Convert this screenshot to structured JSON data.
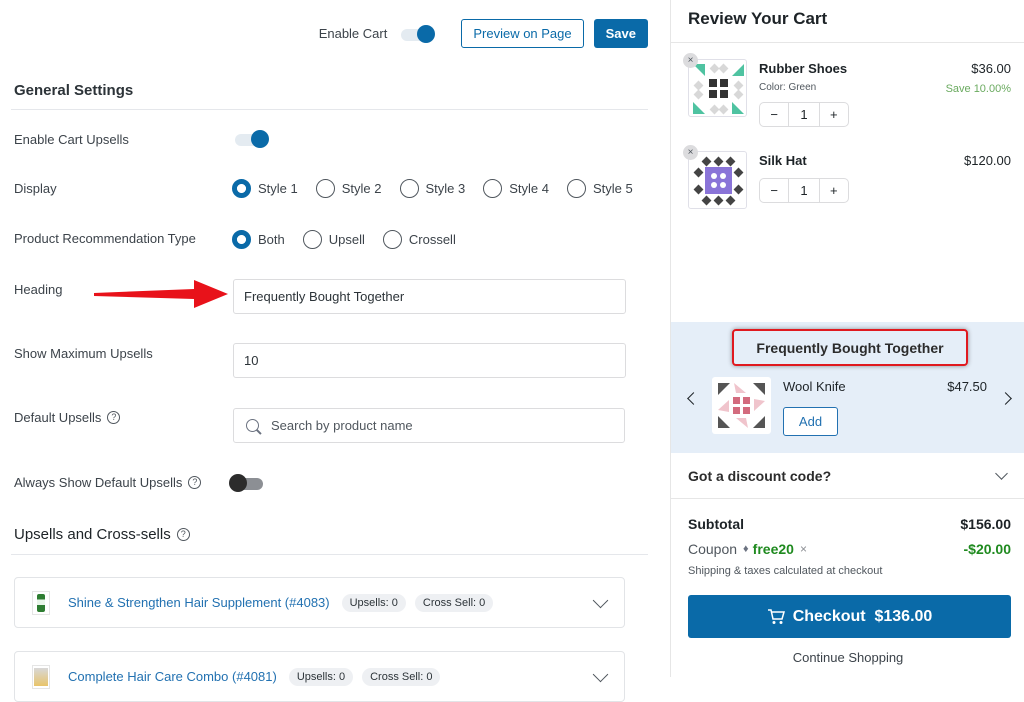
{
  "topbar": {
    "enable_cart_label": "Enable Cart",
    "enable_cart_on": true,
    "preview_label": "Preview on Page",
    "save_label": "Save"
  },
  "general": {
    "title": "General Settings",
    "enable_upsells_label": "Enable Cart Upsells",
    "enable_upsells_on": true,
    "display_label": "Display",
    "display_options": [
      "Style 1",
      "Style 2",
      "Style 3",
      "Style 4",
      "Style 5"
    ],
    "display_selected": "Style 1",
    "rec_type_label": "Product Recommendation Type",
    "rec_type_options": [
      "Both",
      "Upsell",
      "Crossell"
    ],
    "rec_type_selected": "Both",
    "heading_label": "Heading",
    "heading_value": "Frequently Bought Together",
    "max_upsells_label": "Show Maximum Upsells",
    "max_upsells_value": "10",
    "default_upsells_label": "Default Upsells",
    "default_upsells_placeholder": "Search by product name",
    "always_show_label": "Always Show Default Upsells",
    "always_show_on": false,
    "help_glyph": "?"
  },
  "upsells_section": {
    "title": "Upsells and Cross-sells",
    "products": [
      {
        "name": "Shine & Strengthen Hair Supplement (#4083)",
        "upsells": "Upsells: 0",
        "cross_sell": "Cross Sell: 0"
      },
      {
        "name": "Complete Hair Care Combo (#4081)",
        "upsells": "Upsells: 0",
        "cross_sell": "Cross Sell: 0"
      }
    ]
  },
  "cart": {
    "title": "Review Your Cart",
    "remove_glyph": "×",
    "items": [
      {
        "name": "Rubber Shoes",
        "variant": "Color: Green",
        "price": "$36.00",
        "save": "Save 10.00%",
        "qty": "1"
      },
      {
        "name": "Silk Hat",
        "price": "$120.00",
        "qty": "1"
      }
    ],
    "qty_minus": "−",
    "qty_plus": "+",
    "fbt": {
      "title": "Frequently Bought Together",
      "product_name": "Wool Knife",
      "product_price": "$47.50",
      "add_label": "Add"
    },
    "discount_label": "Got a discount code?",
    "subtotal_label": "Subtotal",
    "subtotal_value": "$156.00",
    "coupon_label": "Coupon",
    "coupon_code": "free20",
    "coupon_remove": "×",
    "coupon_value": "-$20.00",
    "shipping_note": "Shipping & taxes calculated at checkout",
    "checkout_label": "Checkout  $136.00",
    "continue_label": "Continue Shopping",
    "accent_color": "#0a6aa8"
  }
}
